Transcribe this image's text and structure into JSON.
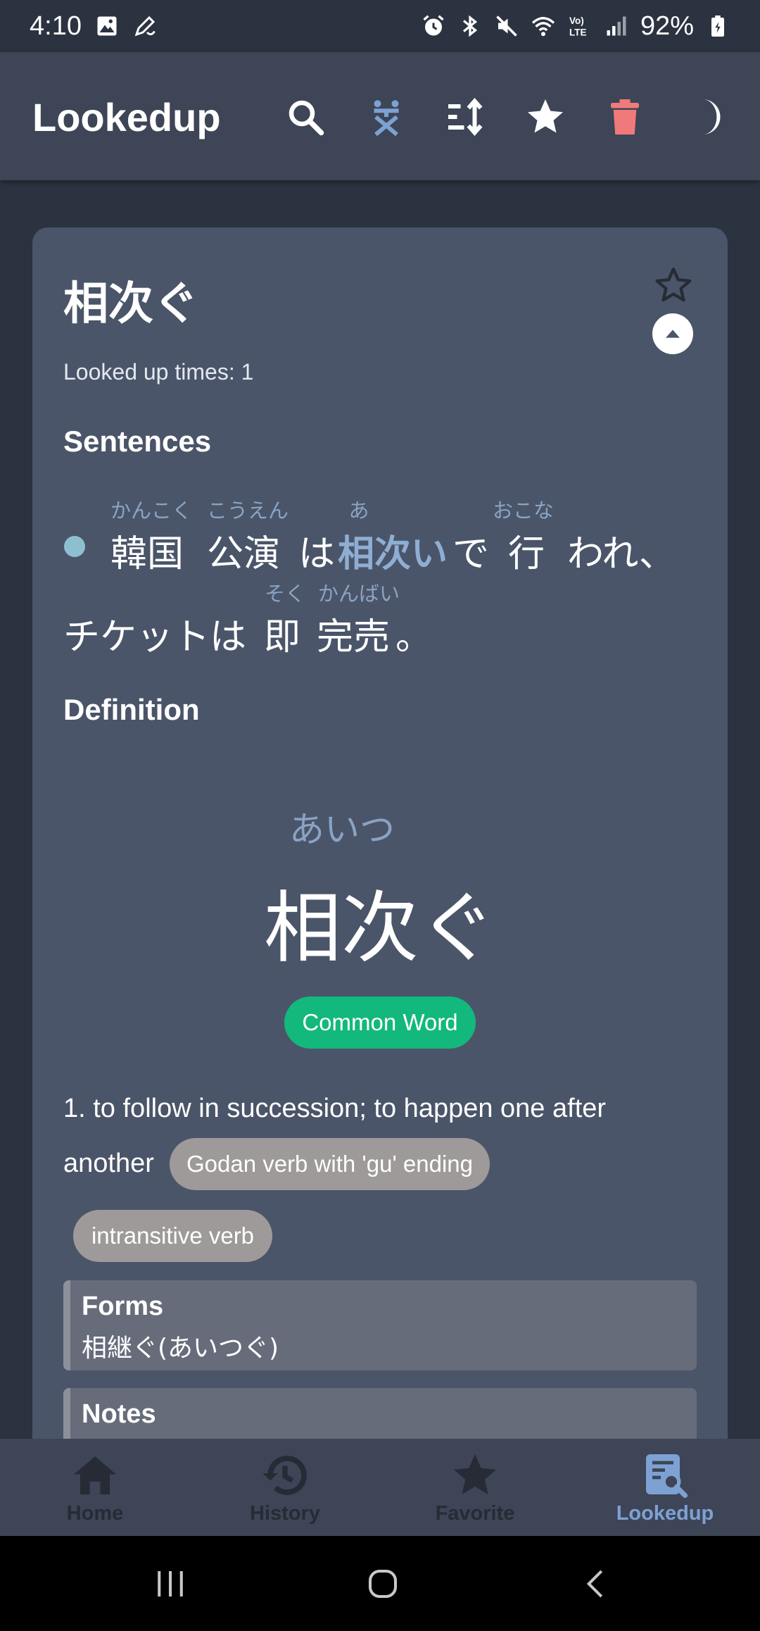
{
  "status_bar": {
    "time": "4:10",
    "battery": "92%",
    "icons_left": [
      "image-icon",
      "pen-icon"
    ],
    "icons_right": [
      "alarm-icon",
      "bluetooth-icon",
      "mute-icon",
      "wifi-icon",
      "volte-icon",
      "signal-icon",
      "battery-icon"
    ],
    "volte_text": "Vo)\nLTE"
  },
  "app_bar": {
    "title": "Lookedup",
    "actions": [
      "search-icon",
      "translate-icon",
      "sort-icon",
      "star-icon",
      "delete-icon",
      "dark-mode-icon"
    ],
    "accent_color": "#7ea1d4",
    "delete_color": "#f07a7a"
  },
  "card": {
    "word": "相次ぐ",
    "lookup_count": "Looked up times: 1",
    "sentences_heading": "Sentences",
    "sentence": {
      "line1": [
        {
          "text": "韓国",
          "furigana": "かんこく"
        },
        {
          "text": "公演",
          "furigana": "こうえん"
        },
        {
          "text": "は",
          "furigana": ""
        },
        {
          "text": "相次い",
          "furigana": "あ",
          "highlight": true
        },
        {
          "text": "で",
          "furigana": ""
        },
        {
          "text": "行",
          "furigana": "おこな"
        },
        {
          "text": "われ、",
          "furigana": ""
        }
      ],
      "line2_prefix": "チケットは",
      "line2_word": "即",
      "line2_word_furigana": "そく",
      "line2_word2": "完売",
      "line2_word2_furigana": "かんばい",
      "line2_suffix": "。"
    },
    "definition_heading": "Definition",
    "reading": "あいつ",
    "big_word": "相次ぐ",
    "common_badge": "Common Word",
    "meaning_line1": "1. to follow in succession; to happen one after",
    "meaning_line2": "another",
    "tags": [
      "Godan verb with 'gu' ending",
      "intransitive verb"
    ],
    "forms_title": "Forms",
    "forms_body": "相継ぐ(あいつぐ)",
    "notes_title": "Notes"
  },
  "bottom_nav": {
    "items": [
      {
        "label": "Home",
        "icon": "home-icon",
        "active": false
      },
      {
        "label": "History",
        "icon": "history-icon",
        "active": false
      },
      {
        "label": "Favorite",
        "icon": "star-icon",
        "active": false
      },
      {
        "label": "Lookedup",
        "icon": "lookup-icon",
        "active": true
      }
    ],
    "inactive_color": "#262b35",
    "active_color": "#7ea1d4"
  },
  "system_nav": [
    "recents-icon",
    "home-circle-icon",
    "back-icon"
  ]
}
